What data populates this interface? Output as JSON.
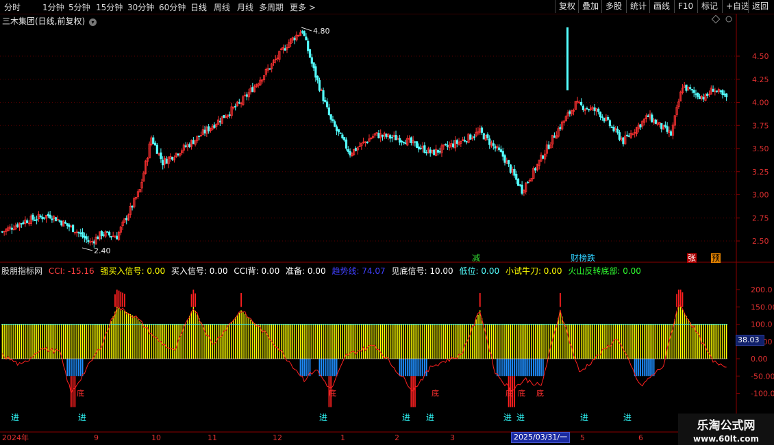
{
  "toolbar": {
    "periods": [
      "分时",
      "1分钟",
      "5分钟",
      "15分钟",
      "30分钟",
      "60分钟",
      "日线",
      "周线",
      "月线",
      "多周期",
      "更多 >"
    ],
    "right_buttons": [
      "复权",
      "叠加",
      "多股",
      "统计",
      "画线",
      "F10",
      "标记",
      "+自选",
      "返回"
    ]
  },
  "stock": {
    "title": "三木集团(日线,前复权)",
    "settings_icon": "chevron-down-icon",
    "high_label": "4.80",
    "low_label": "2.40"
  },
  "price_axis": {
    "ticks": [
      "4.50",
      "4.25",
      "4.00",
      "3.75",
      "3.50",
      "3.25",
      "3.00",
      "2.75",
      "2.50"
    ]
  },
  "price_tags": {
    "jian": "减",
    "caibang": "财榜跌",
    "zhang": "张",
    "yu": "预"
  },
  "indicator": {
    "name": "股朋指标网",
    "cci": "CCI: -15.16",
    "strong_buy": "强买入信号: 0.00",
    "buy": "买入信号: 0.00",
    "cci_back": "CCI背: 0.00",
    "prepare": "准备: 0.00",
    "trend": "趋势线: 74.07",
    "bottom_signal": "见底信号: 10.00",
    "low": "低位: 0.00",
    "small_test": "小试牛刀: 0.00",
    "volcano": "火山反转底部: 0.00",
    "current_value": "38.03",
    "axis_ticks": [
      "200.0",
      "150.00",
      "100.0",
      "50.00",
      "0.00",
      "-50.00",
      "-100.0"
    ],
    "jin_label": "进",
    "di_label": "底"
  },
  "time_axis": {
    "labels": [
      "2024年",
      "9",
      "10",
      "11",
      "12",
      "1",
      "2",
      "3",
      "2025/03/31/一",
      "5",
      "6"
    ]
  },
  "watermark": {
    "name": "乐淘公式网",
    "url": "www.60lt.com"
  },
  "colors": {
    "up": "#ff3232",
    "down": "#54ffff",
    "yellow": "#ffff00",
    "trend": "#3a3aff",
    "axis": "#8b0000"
  },
  "chart_data": {
    "type": "candlestick",
    "price_anchors": [
      [
        0,
        2.6
      ],
      [
        12,
        2.72
      ],
      [
        25,
        2.78
      ],
      [
        38,
        2.62
      ],
      [
        46,
        2.48
      ],
      [
        52,
        2.58
      ],
      [
        60,
        2.55
      ],
      [
        72,
        3.05
      ],
      [
        78,
        3.62
      ],
      [
        84,
        3.35
      ],
      [
        98,
        3.55
      ],
      [
        110,
        3.75
      ],
      [
        125,
        4.0
      ],
      [
        140,
        4.38
      ],
      [
        150,
        4.65
      ],
      [
        157,
        4.78
      ],
      [
        163,
        4.35
      ],
      [
        172,
        3.8
      ],
      [
        182,
        3.45
      ],
      [
        195,
        3.65
      ],
      [
        210,
        3.6
      ],
      [
        225,
        3.45
      ],
      [
        240,
        3.58
      ],
      [
        250,
        3.68
      ],
      [
        262,
        3.42
      ],
      [
        272,
        3.05
      ],
      [
        278,
        3.25
      ],
      [
        290,
        3.68
      ],
      [
        300,
        3.98
      ],
      [
        312,
        3.9
      ],
      [
        325,
        3.58
      ],
      [
        338,
        3.85
      ],
      [
        350,
        3.65
      ],
      [
        356,
        4.18
      ],
      [
        362,
        4.1
      ],
      [
        368,
        4.05
      ],
      [
        372,
        4.15
      ],
      [
        378,
        4.05
      ]
    ],
    "cci_anchors": [
      [
        0,
        10
      ],
      [
        10,
        -20
      ],
      [
        20,
        30
      ],
      [
        30,
        20
      ],
      [
        36,
        -100
      ],
      [
        44,
        -30
      ],
      [
        52,
        40
      ],
      [
        60,
        150
      ],
      [
        70,
        120
      ],
      [
        80,
        60
      ],
      [
        90,
        20
      ],
      [
        100,
        150
      ],
      [
        110,
        40
      ],
      [
        125,
        140
      ],
      [
        140,
        60
      ],
      [
        158,
        -60
      ],
      [
        164,
        -30
      ],
      [
        172,
        -90
      ],
      [
        180,
        10
      ],
      [
        195,
        40
      ],
      [
        215,
        -90
      ],
      [
        225,
        -20
      ],
      [
        240,
        10
      ],
      [
        250,
        140
      ],
      [
        258,
        -40
      ],
      [
        266,
        -90
      ],
      [
        274,
        -60
      ],
      [
        282,
        -80
      ],
      [
        292,
        140
      ],
      [
        302,
        -40
      ],
      [
        312,
        10
      ],
      [
        322,
        60
      ],
      [
        334,
        -80
      ],
      [
        346,
        -20
      ],
      [
        354,
        160
      ],
      [
        364,
        70
      ],
      [
        372,
        -10
      ],
      [
        380,
        -20
      ]
    ],
    "trend_level": 74.07,
    "ylim_price": [
      2.4,
      4.8
    ],
    "ylim_cci": [
      -150,
      250
    ]
  }
}
